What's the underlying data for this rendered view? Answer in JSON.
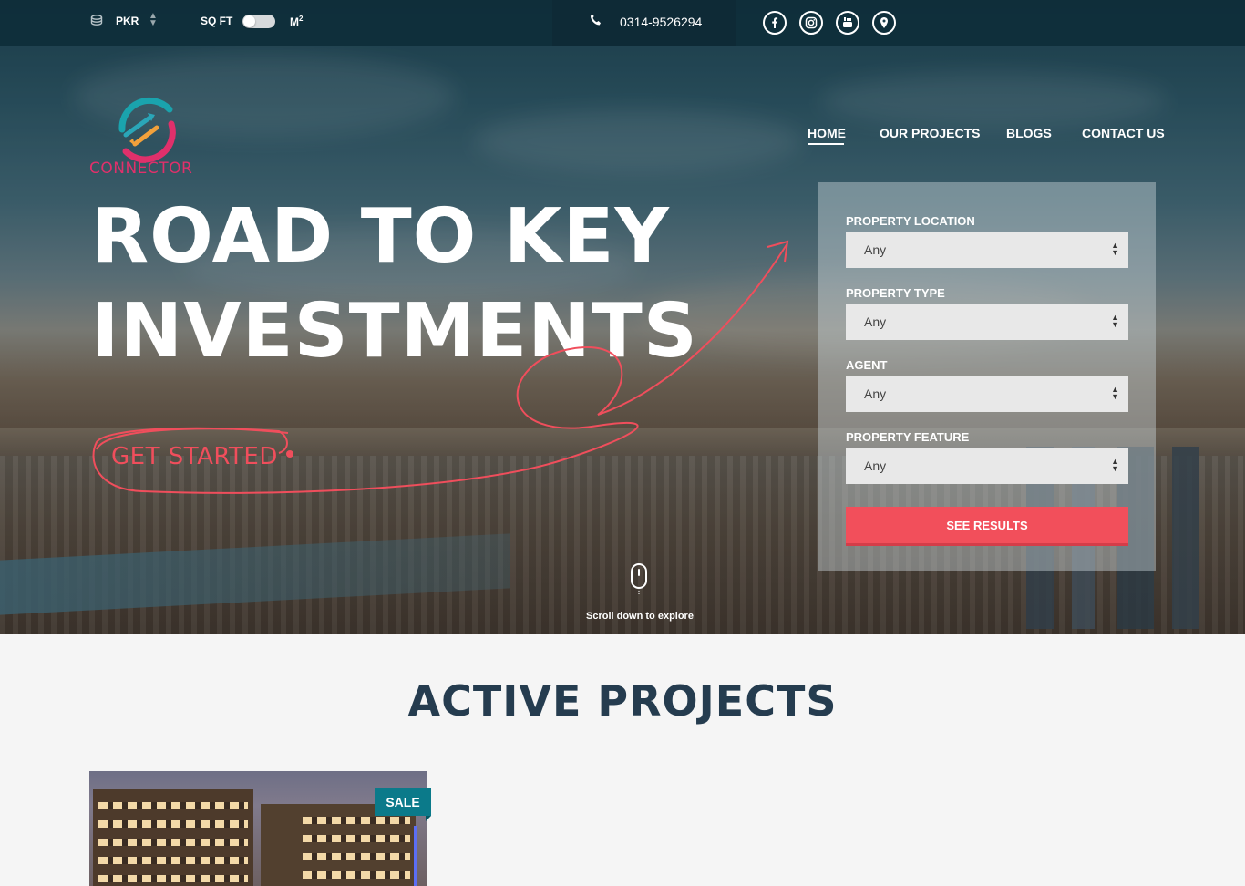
{
  "topbar": {
    "currency": "PKR",
    "unit_left": "SQ FT",
    "unit_right_base": "M",
    "unit_right_sup": "2",
    "unit_toggle_state": "sqft",
    "phone": "0314-9526294",
    "social_icons": [
      "facebook-icon",
      "instagram-icon",
      "youtube-icon",
      "location-pin-icon"
    ]
  },
  "logo": {
    "text": "CONNECTOR"
  },
  "nav": {
    "items": [
      {
        "label": "HOME",
        "active": true
      },
      {
        "label": "OUR PROJECTS",
        "active": false
      },
      {
        "label": "BLOGS",
        "active": false
      },
      {
        "label": "CONTACT US",
        "active": false
      }
    ]
  },
  "hero": {
    "headline_line1": "ROAD TO KEY",
    "headline_line2": "INVESTMENTS",
    "cta": "GET STARTED",
    "scroll_text": "Scroll down to explore"
  },
  "search": {
    "fields": [
      {
        "label": "PROPERTY LOCATION",
        "value": "Any"
      },
      {
        "label": "PROPERTY TYPE",
        "value": "Any"
      },
      {
        "label": "AGENT",
        "value": "Any"
      },
      {
        "label": "PROPERTY FEATURE",
        "value": "Any"
      }
    ],
    "submit": "SEE RESULTS"
  },
  "projects": {
    "title": "ACTIVE PROJECTS",
    "cards": [
      {
        "badge": "SALE"
      }
    ]
  },
  "colors": {
    "accent": "#f24f5b",
    "topbar": "#0e2e3a",
    "heading": "#253c4f",
    "badge": "#0b7a8a"
  }
}
